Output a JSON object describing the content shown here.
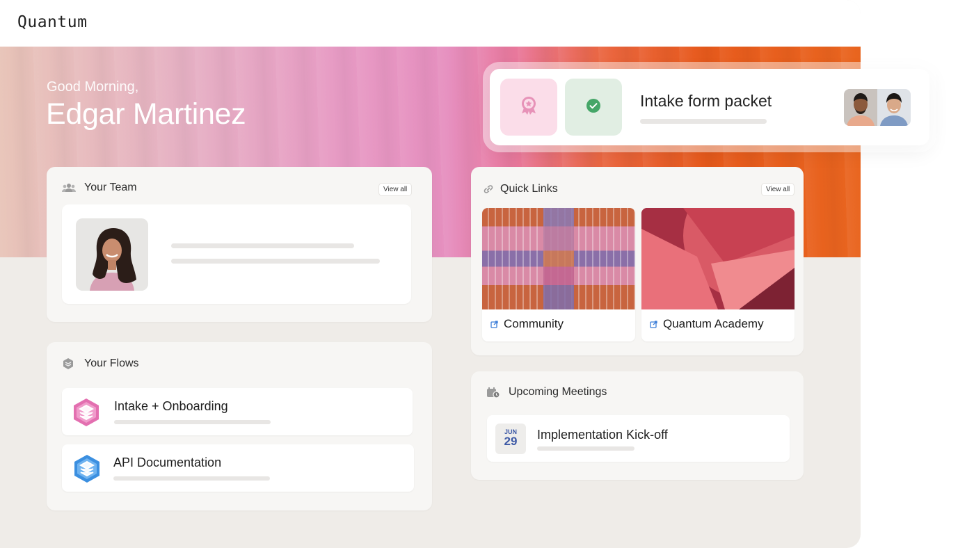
{
  "app": {
    "brand": "Quantum"
  },
  "greeting": {
    "salutation": "Good Morning,",
    "name": "Edgar Martinez"
  },
  "notification": {
    "title": "Intake form packet"
  },
  "team": {
    "title": "Your Team",
    "view_all": "View all"
  },
  "quick_links": {
    "title": "Quick Links",
    "view_all": "View all",
    "items": [
      {
        "label": "Community"
      },
      {
        "label": "Quantum Academy"
      }
    ]
  },
  "flows": {
    "title": "Your Flows",
    "items": [
      {
        "label": "Intake + Onboarding",
        "color": "#e36fb0"
      },
      {
        "label": "API Documentation",
        "color": "#3b8fe0"
      }
    ]
  },
  "meetings": {
    "title": "Upcoming Meetings",
    "items": [
      {
        "month": "JUN",
        "day": "29",
        "title": "Implementation Kick-off"
      }
    ]
  },
  "colors": {
    "accent_orange": "#e75a1c",
    "accent_pink": "#e68fbf",
    "date_blue": "#3e5aa6"
  }
}
